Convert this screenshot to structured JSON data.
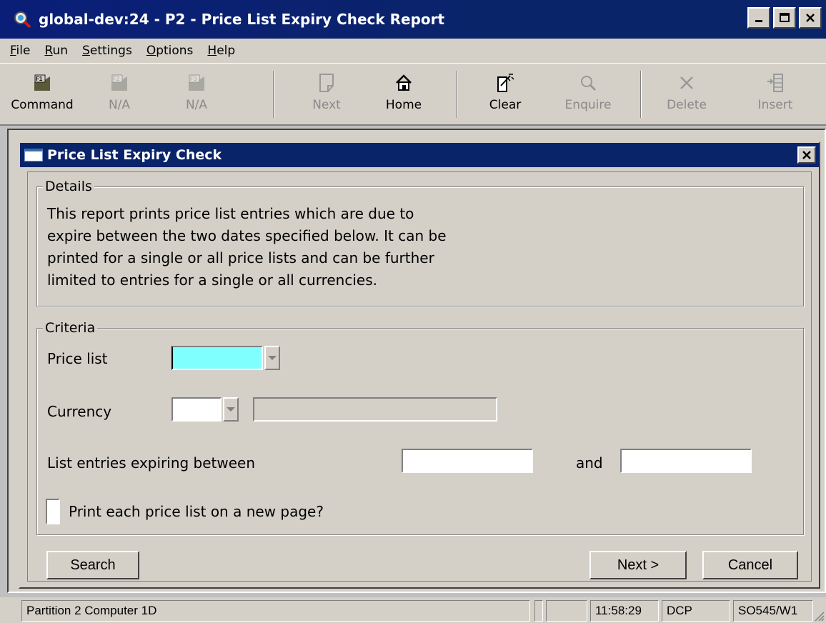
{
  "window": {
    "title": "global-dev:24 - P2 - Price List Expiry Check Report",
    "controls": [
      "_",
      "□",
      "✕"
    ]
  },
  "menu": [
    {
      "label": "File",
      "underline": "F",
      "rest": "ile"
    },
    {
      "label": "Run",
      "underline": "R",
      "rest": "un"
    },
    {
      "label": "Settings",
      "underline": "S",
      "rest": "ettings"
    },
    {
      "label": "Options",
      "underline": "O",
      "rest": "ptions"
    },
    {
      "label": "Help",
      "underline": "H",
      "rest": "elp"
    }
  ],
  "toolbar": {
    "command": "Command",
    "f2": "N/A",
    "f3": "N/A",
    "next": "Next",
    "home": "Home",
    "clear": "Clear",
    "enquire": "Enquire",
    "delete": "Delete",
    "insert": "Insert",
    "f1_key": "F1",
    "f2_key": "F2",
    "f3_key": "F3"
  },
  "dialog": {
    "title": "Price List Expiry Check",
    "details": {
      "legend": "Details",
      "lines": [
        "This report prints price list entries which are due to",
        "expire between the two dates specified below. It can be",
        "printed for a single or all price lists and can be further",
        "limited to entries for a single or all currencies."
      ]
    },
    "criteria": {
      "legend": "Criteria",
      "price_list_label": "Price list",
      "price_list_value": "",
      "currency_label": "Currency",
      "currency_value": "",
      "currency_desc": "",
      "expiring_label": "List entries expiring between",
      "and_label": "and",
      "from_date": "",
      "to_date": "",
      "new_page_label": "Print each price list on a new page?",
      "new_page_checked": false
    },
    "buttons": {
      "search": "Search",
      "next": "Next >",
      "cancel": "Cancel"
    }
  },
  "status": {
    "location": "Partition 2 Computer 1D",
    "time": "11:58:29",
    "user": "DCP",
    "session": "SO545/W1"
  }
}
